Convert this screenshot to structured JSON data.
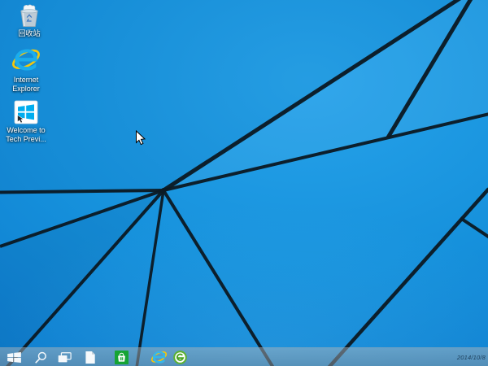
{
  "desktop": {
    "icons": [
      {
        "name": "recycle-bin",
        "label": "回收站"
      },
      {
        "name": "internet-explorer",
        "label_line1": "Internet",
        "label_line2": "Explorer"
      },
      {
        "name": "welcome-tech-preview",
        "label_line1": "Welcome to",
        "label_line2": "Tech Previ..."
      }
    ],
    "cursor_icon": "arrow-pointer"
  },
  "taskbar": {
    "buttons": [
      {
        "icon": "windows-start-icon"
      },
      {
        "icon": "search-icon"
      },
      {
        "icon": "task-view-icon"
      },
      {
        "icon": "document-icon"
      },
      {
        "icon": "windows-store-icon"
      },
      {
        "icon": "internet-explorer-icon"
      },
      {
        "icon": "360-browser-icon"
      }
    ],
    "clock_date": "2014/10/8"
  },
  "colors": {
    "wallpaper_blue": "#1591dc",
    "wallpaper_line": "#0b1a24",
    "taskbar_tint": "#5699c2",
    "store_green": "#16a434",
    "ie_blue": "#1badec",
    "ie_swoosh_yellow": "#f6c80a",
    "browser360_green": "#5cb231",
    "welcome_tile_blue": "#00adef"
  }
}
